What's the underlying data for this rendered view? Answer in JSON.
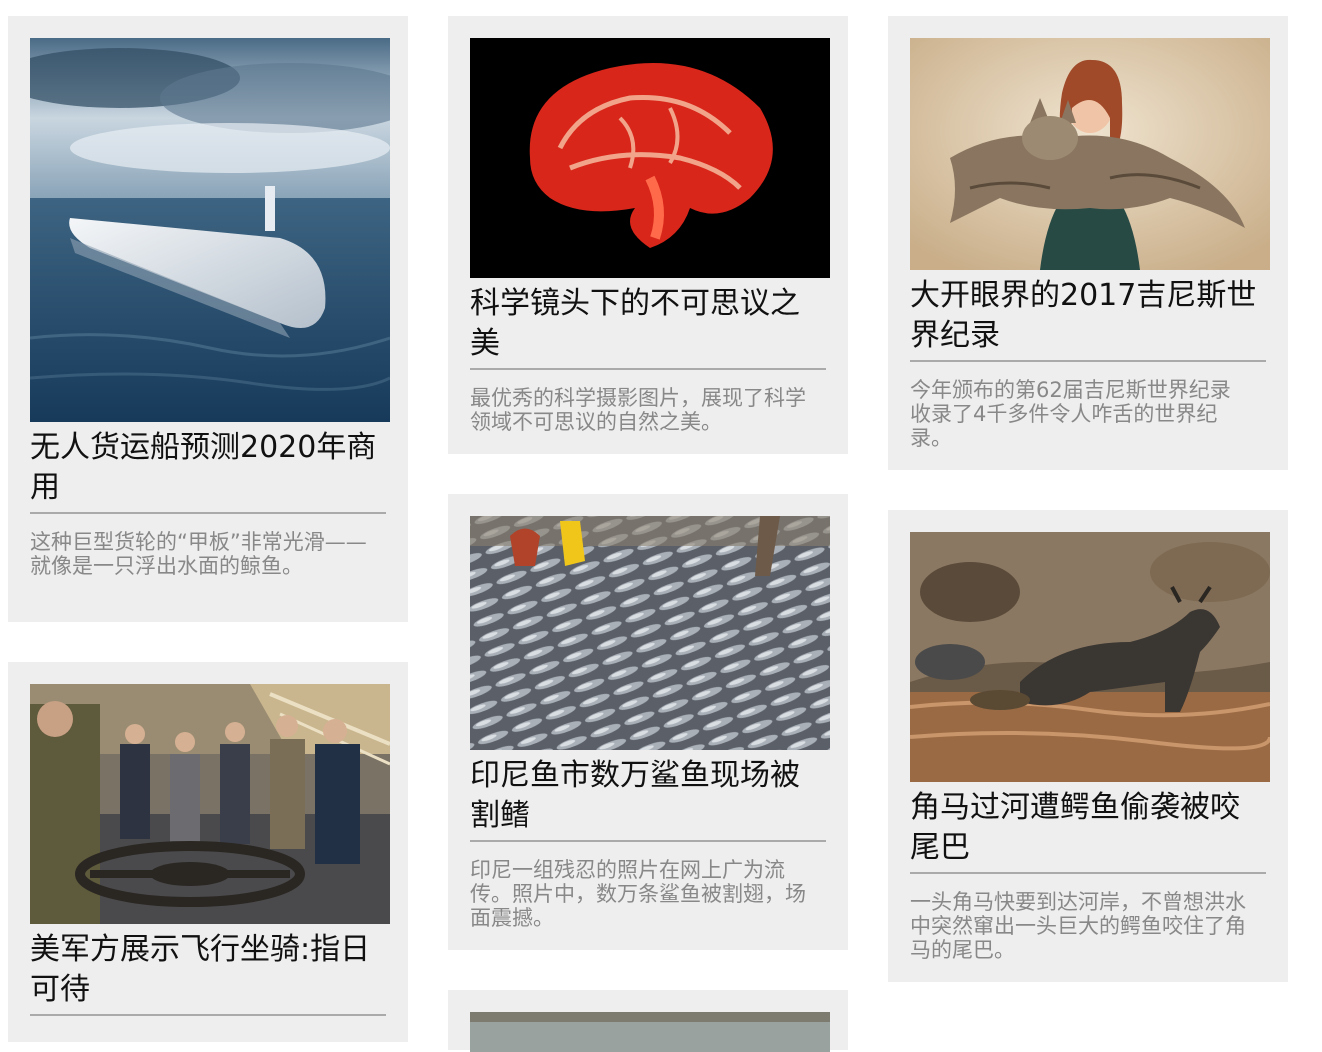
{
  "cards": [
    {
      "title": "无人货运船预测2020年商用",
      "desc": "这种巨型货轮的“甲板”非常光滑——就像是一只浮出水面的鲸鱼。",
      "image": "autonomous-cargo-ship-photo"
    },
    {
      "title": "科学镜头下的不可思议之美",
      "desc": "最优秀的科学摄影图片，展现了科学领域不可思议的自然之美。",
      "image": "red-brain-section-photo"
    },
    {
      "title": "大开眼界的2017吉尼斯世界纪录",
      "desc": "今年颁布的第62届吉尼斯世界纪录收录了4千多件令人咋舌的世界纪录。",
      "image": "woman-holding-long-cat-photo"
    },
    {
      "title": "美军方展示飞行坐骑:指日可待",
      "desc": "",
      "image": "military-hoverbike-demo-photo"
    },
    {
      "title": "印尼鱼市数万鲨鱼现场被割鳍",
      "desc": "印尼一组残忍的照片在网上广为流传。照片中，数万条鲨鱼被割翅，场面震撼。",
      "image": "shark-fish-market-photo"
    },
    {
      "title": "角马过河遭鳄鱼偷袭被咬尾巴",
      "desc": "一头角马快要到达河岸，不曾想洪水中突然窜出一头巨大的鳄鱼咬住了角马的尾巴。",
      "image": "wildebeest-river-crocodile-photo"
    },
    {
      "title": "",
      "desc": "",
      "image": "partial-card-photo"
    }
  ]
}
